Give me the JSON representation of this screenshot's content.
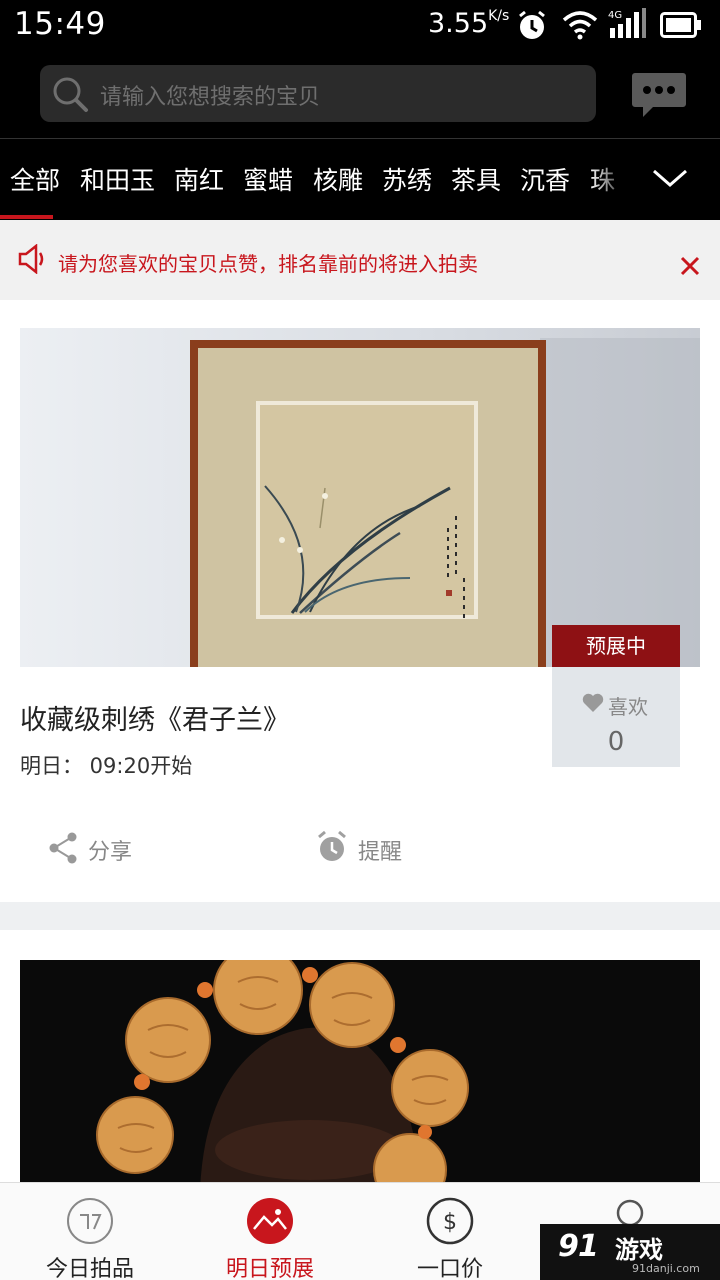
{
  "status_bar": {
    "time": "15:49",
    "net_speed": "3.55",
    "net_unit": "K/s",
    "network": "4G"
  },
  "search": {
    "placeholder": "请输入您想搜索的宝贝"
  },
  "categories": [
    "全部",
    "和田玉",
    "南红",
    "蜜蜡",
    "核雕",
    "苏绣",
    "茶具",
    "沉香",
    "珠"
  ],
  "notice": {
    "text": "请为您喜欢的宝贝点赞，排名靠前的将进入拍卖"
  },
  "items": [
    {
      "title": "收藏级刺绣《君子兰》",
      "start": "明日：  09:20开始",
      "status": "预展中",
      "like_label": "喜欢",
      "like_count": "0",
      "share_label": "分享",
      "remind_label": "提醒"
    }
  ],
  "tabs": [
    {
      "label": "今日拍品"
    },
    {
      "label": "明日预展"
    },
    {
      "label": "一口价"
    },
    {
      "label": ""
    }
  ],
  "watermark": {
    "brand": "游戏",
    "site": "91danji.com"
  },
  "colors": {
    "accent": "#c8161d",
    "badge": "#8e1114",
    "header": "#000000"
  }
}
